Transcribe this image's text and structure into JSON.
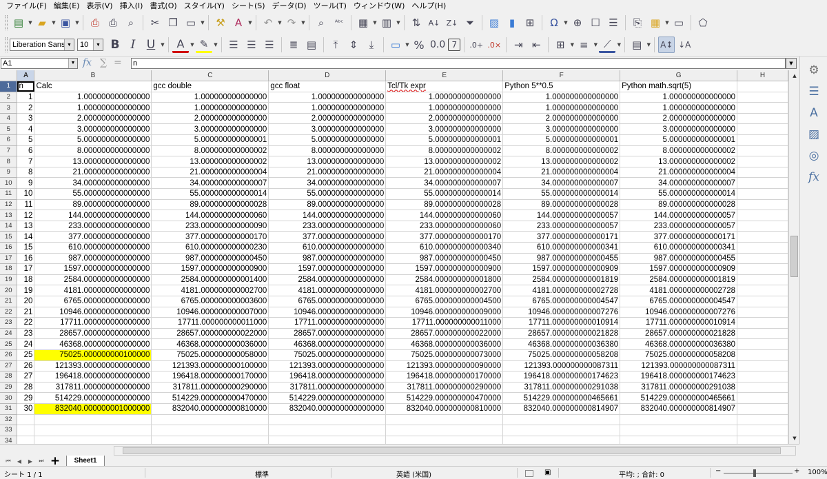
{
  "menu": [
    "ファイル(F)",
    "編集(E)",
    "表示(V)",
    "挿入(I)",
    "書式(O)",
    "スタイル(Y)",
    "シート(S)",
    "データ(D)",
    "ツール(T)",
    "ウィンドウ(W)",
    "ヘルプ(H)"
  ],
  "toolbar": {
    "font_name": "Liberation Sans",
    "font_size": "10",
    "bold": "B",
    "italic": "I",
    "underline": "U",
    "percent": "%",
    "number_format": "0.0",
    "decimals": "7"
  },
  "formula_bar": {
    "cell_ref": "A1",
    "content": "n"
  },
  "columns": [
    "A",
    "B",
    "C",
    "D",
    "E",
    "F",
    "G",
    "H"
  ],
  "headers": [
    "n",
    "Calc",
    "gcc double",
    "gcc float",
    "Tcl/Tk expr",
    "Python 5**0.5",
    "Python math.sqrt(5)"
  ],
  "rows": [
    {
      "n": "1",
      "b": "1.000000000000000",
      "c": "1.000000000000000",
      "d": "1.000000000000000",
      "e": "1.000000000000000",
      "f": "1.000000000000000",
      "g": "1.000000000000000"
    },
    {
      "n": "2",
      "b": "1.000000000000000",
      "c": "1.000000000000000",
      "d": "1.000000000000000",
      "e": "1.000000000000000",
      "f": "1.000000000000000",
      "g": "1.000000000000000"
    },
    {
      "n": "3",
      "b": "2.000000000000000",
      "c": "2.000000000000000",
      "d": "2.000000000000000",
      "e": "2.000000000000000",
      "f": "2.000000000000000",
      "g": "2.000000000000000"
    },
    {
      "n": "4",
      "b": "3.000000000000000",
      "c": "3.000000000000000",
      "d": "3.000000000000000",
      "e": "3.000000000000000",
      "f": "3.000000000000000",
      "g": "3.000000000000000"
    },
    {
      "n": "5",
      "b": "5.000000000000000",
      "c": "5.000000000000001",
      "d": "5.000000000000000",
      "e": "5.000000000000001",
      "f": "5.000000000000001",
      "g": "5.000000000000001"
    },
    {
      "n": "6",
      "b": "8.000000000000000",
      "c": "8.000000000000002",
      "d": "8.000000000000000",
      "e": "8.000000000000002",
      "f": "8.000000000000002",
      "g": "8.000000000000002"
    },
    {
      "n": "7",
      "b": "13.000000000000000",
      "c": "13.000000000000002",
      "d": "13.000000000000000",
      "e": "13.000000000000002",
      "f": "13.000000000000002",
      "g": "13.000000000000002"
    },
    {
      "n": "8",
      "b": "21.000000000000000",
      "c": "21.000000000000004",
      "d": "21.000000000000000",
      "e": "21.000000000000004",
      "f": "21.000000000000004",
      "g": "21.000000000000004"
    },
    {
      "n": "9",
      "b": "34.000000000000000",
      "c": "34.000000000000007",
      "d": "34.000000000000000",
      "e": "34.000000000000007",
      "f": "34.000000000000007",
      "g": "34.000000000000007"
    },
    {
      "n": "10",
      "b": "55.000000000000000",
      "c": "55.000000000000014",
      "d": "55.000000000000000",
      "e": "55.000000000000014",
      "f": "55.000000000000014",
      "g": "55.000000000000014"
    },
    {
      "n": "11",
      "b": "89.000000000000000",
      "c": "89.000000000000028",
      "d": "89.000000000000000",
      "e": "89.000000000000028",
      "f": "89.000000000000028",
      "g": "89.000000000000028"
    },
    {
      "n": "12",
      "b": "144.000000000000000",
      "c": "144.000000000000060",
      "d": "144.000000000000000",
      "e": "144.000000000000060",
      "f": "144.000000000000057",
      "g": "144.000000000000057"
    },
    {
      "n": "13",
      "b": "233.000000000000000",
      "c": "233.000000000000090",
      "d": "233.000000000000000",
      "e": "233.000000000000060",
      "f": "233.000000000000057",
      "g": "233.000000000000057"
    },
    {
      "n": "14",
      "b": "377.000000000000000",
      "c": "377.000000000000170",
      "d": "377.000000000000000",
      "e": "377.000000000000170",
      "f": "377.000000000000171",
      "g": "377.000000000000171"
    },
    {
      "n": "15",
      "b": "610.000000000000000",
      "c": "610.000000000000230",
      "d": "610.000000000000000",
      "e": "610.000000000000340",
      "f": "610.000000000000341",
      "g": "610.000000000000341"
    },
    {
      "n": "16",
      "b": "987.000000000000000",
      "c": "987.000000000000450",
      "d": "987.000000000000000",
      "e": "987.000000000000450",
      "f": "987.000000000000455",
      "g": "987.000000000000455"
    },
    {
      "n": "17",
      "b": "1597.000000000000000",
      "c": "1597.000000000000900",
      "d": "1597.000000000000000",
      "e": "1597.000000000000900",
      "f": "1597.000000000000909",
      "g": "1597.000000000000909"
    },
    {
      "n": "18",
      "b": "2584.000000000000000",
      "c": "2584.000000000001400",
      "d": "2584.000000000000000",
      "e": "2584.000000000001800",
      "f": "2584.000000000001819",
      "g": "2584.000000000001819"
    },
    {
      "n": "19",
      "b": "4181.000000000000000",
      "c": "4181.000000000002700",
      "d": "4181.000000000000000",
      "e": "4181.000000000002700",
      "f": "4181.000000000002728",
      "g": "4181.000000000002728"
    },
    {
      "n": "20",
      "b": "6765.000000000000000",
      "c": "6765.000000000003600",
      "d": "6765.000000000000000",
      "e": "6765.000000000004500",
      "f": "6765.000000000004547",
      "g": "6765.000000000004547"
    },
    {
      "n": "21",
      "b": "10946.000000000000000",
      "c": "10946.000000000007000",
      "d": "10946.000000000000000",
      "e": "10946.000000000009000",
      "f": "10946.000000000007276",
      "g": "10946.000000000007276"
    },
    {
      "n": "22",
      "b": "17711.000000000000000",
      "c": "17711.000000000011000",
      "d": "17711.000000000000000",
      "e": "17711.000000000011000",
      "f": "17711.000000000010914",
      "g": "17711.000000000010914"
    },
    {
      "n": "23",
      "b": "28657.000000000000000",
      "c": "28657.000000000022000",
      "d": "28657.000000000000000",
      "e": "28657.000000000022000",
      "f": "28657.000000000021828",
      "g": "28657.000000000021828"
    },
    {
      "n": "24",
      "b": "46368.000000000000000",
      "c": "46368.000000000036000",
      "d": "46368.000000000000000",
      "e": "46368.000000000036000",
      "f": "46368.000000000036380",
      "g": "46368.000000000036380"
    },
    {
      "n": "25",
      "b": "75025.000000000100000",
      "c": "75025.000000000058000",
      "d": "75025.000000000000000",
      "e": "75025.000000000073000",
      "f": "75025.000000000058208",
      "g": "75025.000000000058208",
      "hl": true
    },
    {
      "n": "26",
      "b": "121393.000000000000000",
      "c": "121393.000000000100000",
      "d": "121393.000000000000000",
      "e": "121393.000000000090000",
      "f": "121393.000000000087311",
      "g": "121393.000000000087311"
    },
    {
      "n": "27",
      "b": "196418.000000000000000",
      "c": "196418.000000000170000",
      "d": "196418.000000000000000",
      "e": "196418.000000000170000",
      "f": "196418.000000000174623",
      "g": "196418.000000000174623"
    },
    {
      "n": "28",
      "b": "317811.000000000000000",
      "c": "317811.000000000290000",
      "d": "317811.000000000000000",
      "e": "317811.000000000290000",
      "f": "317811.000000000291038",
      "g": "317811.000000000291038"
    },
    {
      "n": "29",
      "b": "514229.000000000000000",
      "c": "514229.000000000470000",
      "d": "514229.000000000000000",
      "e": "514229.000000000470000",
      "f": "514229.000000000465661",
      "g": "514229.000000000465661"
    },
    {
      "n": "30",
      "b": "832040.000000001000000",
      "c": "832040.000000000810000",
      "d": "832040.000000000000000",
      "e": "832040.000000000810000",
      "f": "832040.000000000814907",
      "g": "832040.000000000814907",
      "hl": true
    }
  ],
  "row_labels": [
    "1",
    "2",
    "3",
    "4",
    "5",
    "6",
    "7",
    "8",
    "9",
    "10",
    "11",
    "12",
    "13",
    "14",
    "15",
    "16",
    "17",
    "18",
    "19",
    "20",
    "21",
    "22",
    "23",
    "24",
    "25",
    "26",
    "27",
    "28",
    "29",
    "30",
    "31",
    "32",
    "33",
    "34"
  ],
  "sheet_tab": "Sheet1",
  "status": {
    "sheet": "シート 1 / 1",
    "style": "標準",
    "language": "英語 (米国)",
    "summary": "平均: ; 合計: 0",
    "zoom": "100%"
  },
  "colors": {
    "highlight": "#ffff00",
    "accent": "#4d6a9a"
  }
}
